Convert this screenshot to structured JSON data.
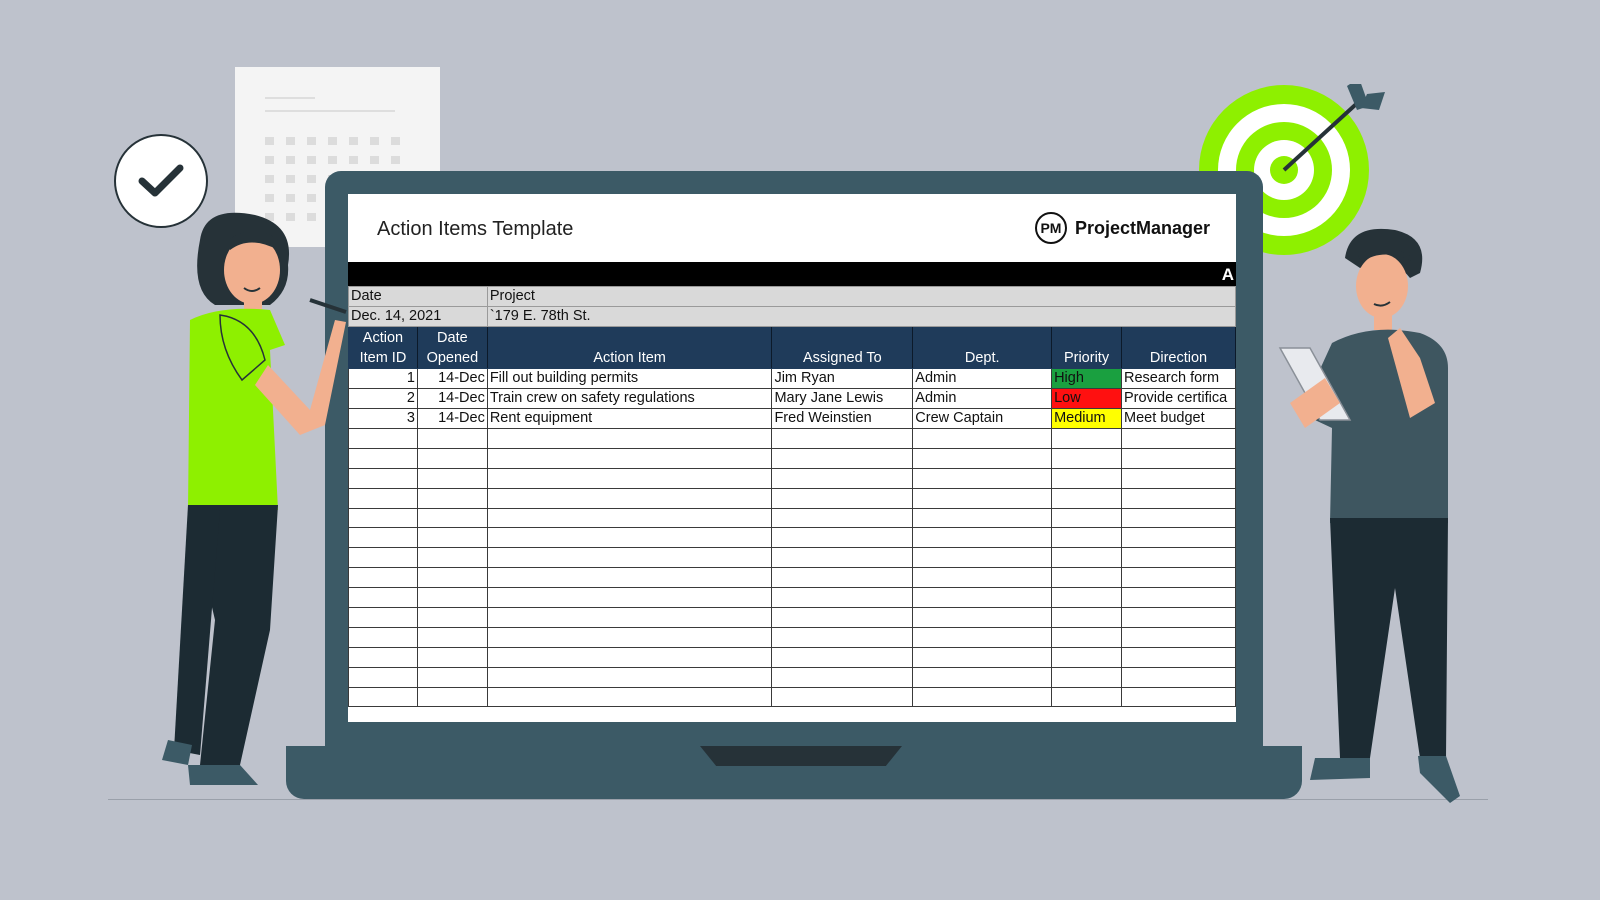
{
  "document": {
    "title": "Action Items Template",
    "banner_text": "A"
  },
  "brand": {
    "logo_text": "PM",
    "name": "ProjectManager"
  },
  "info": {
    "date_label": "Date",
    "date_value": "Dec. 14, 2021",
    "project_label": "Project",
    "project_value": "`179 E. 78th St."
  },
  "table": {
    "headers": {
      "id": [
        "Action",
        "Item ID"
      ],
      "date": [
        "Date",
        "Opened"
      ],
      "item": "Action Item",
      "assigned": "Assigned To",
      "dept": "Dept.",
      "priority": "Priority",
      "direction": "Direction"
    },
    "rows": [
      {
        "id": "1",
        "date": "14-Dec",
        "item": "Fill out building permits",
        "assigned": "Jim Ryan",
        "dept": "Admin",
        "priority": "High",
        "direction": "Research form"
      },
      {
        "id": "2",
        "date": "14-Dec",
        "item": "Train crew on safety regulations",
        "assigned": "Mary Jane Lewis",
        "dept": "Admin",
        "priority": "Low",
        "direction": "Provide certifica"
      },
      {
        "id": "3",
        "date": "14-Dec",
        "item": "Rent equipment",
        "assigned": "Fred Weinstien",
        "dept": "Crew Captain",
        "priority": "Medium",
        "direction": "Meet budget"
      }
    ],
    "empty_rows": 14
  },
  "priority_colors": {
    "High": "#1aa040",
    "Low": "#ff1010",
    "Medium": "#ffff00"
  },
  "icons": [
    "check-icon",
    "calendar-icon",
    "target-icon"
  ],
  "colors": {
    "background": "#bec2cc",
    "laptop": "#3c5a66",
    "header_blue": "#1f3b5a",
    "accent_green": "#8ef000"
  }
}
